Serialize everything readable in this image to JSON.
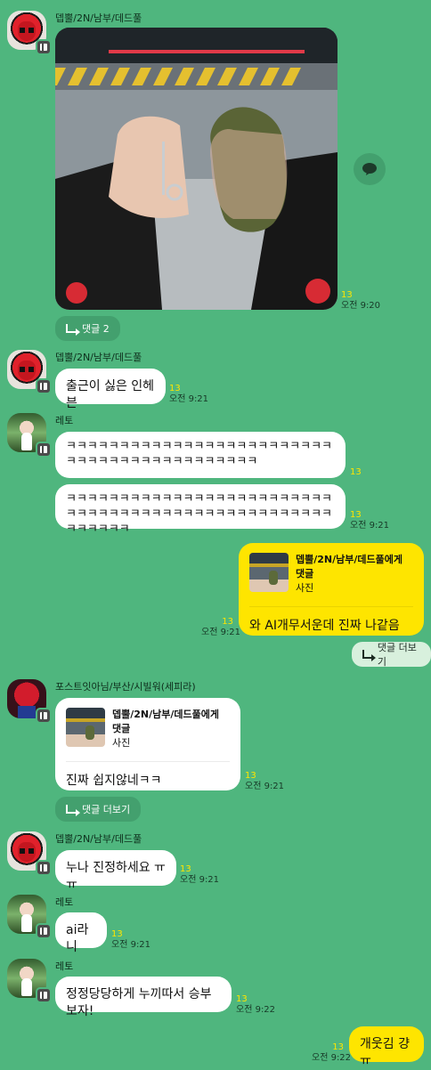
{
  "colors": {
    "background": "#4fb67e",
    "bubble_other": "#ffffff",
    "bubble_me": "#fee500",
    "unread_count": "#fee500"
  },
  "messages": [
    {
      "sender": "뎁뿔/2N/남부/데드풀",
      "avatar": "deadpool-avatar",
      "type": "photo",
      "unread": "13",
      "time": "오전 9:20",
      "reply_button": "댓글 2"
    },
    {
      "sender": "뎁뿔/2N/남부/데드풀",
      "avatar": "deadpool-avatar",
      "text": "출근이 싫은 인헤븐",
      "unread": "13",
      "time": "오전 9:21"
    },
    {
      "sender": "레토",
      "avatar": "green-avatar",
      "text": "ㅋㅋㅋㅋㅋㅋㅋㅋㅋㅋㅋㅋㅋㅋㅋㅋㅋㅋㅋㅋㅋㅋㅋㅋㅋㅋㅋㅋㅋㅋㅋㅋㅋㅋㅋㅋㅋㅋㅋㅋㅋㅋㅋ",
      "unread": "13"
    },
    {
      "text": "ㅋㅋㅋㅋㅋㅋㅋㅋㅋㅋㅋㅋㅋㅋㅋㅋㅋㅋㅋㅋㅋㅋㅋㅋㅋㅋㅋㅋㅋㅋㅋㅋㅋㅋㅋㅋㅋㅋㅋㅋㅋㅋㅋㅋㅋㅋㅋㅋㅋㅋㅋㅋㅋㅋㅋㅋ",
      "unread": "13",
      "time": "오전 9:21"
    },
    {
      "from_me": true,
      "quote_title": "뎁뿔/2N/남부/데드풀에게 댓글",
      "quote_sub": "사진",
      "text": "와 AI개무서운데 진짜 나같음",
      "unread": "13",
      "time": "오전 9:21",
      "reply_button": "댓글 더보기"
    },
    {
      "sender": "포스트잇아님/부산/시빌워(세피라)",
      "avatar": "spiderman-avatar",
      "quote_title": "뎁뿔/2N/남부/데드풀에게 댓글",
      "quote_sub": "사진",
      "text": "진짜 쉽지않네ㅋㅋ",
      "unread": "13",
      "time": "오전 9:21",
      "reply_button": "댓글 더보기"
    },
    {
      "sender": "뎁뿔/2N/남부/데드풀",
      "avatar": "deadpool-avatar",
      "text": "누나 진정하세요 ㅠㅠ",
      "unread": "13",
      "time": "오전 9:21"
    },
    {
      "sender": "레토",
      "avatar": "green-avatar",
      "text": "ai라니",
      "unread": "13",
      "time": "오전 9:21"
    },
    {
      "sender": "레토",
      "avatar": "green-avatar",
      "text": "정정당당하게 누끼따서 승부보자!",
      "unread": "13",
      "time": "오전 9:22"
    },
    {
      "from_me": true,
      "text": "개웃김 걍ㅠ",
      "unread": "13",
      "time": "오전 9:22"
    }
  ]
}
